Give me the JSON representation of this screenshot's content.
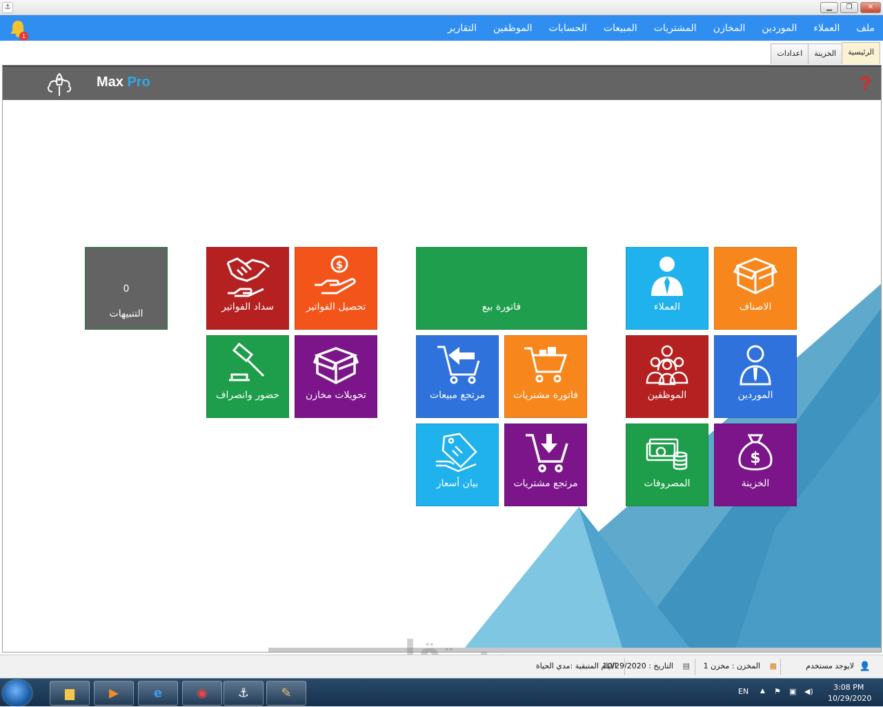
{
  "window": {
    "app_icon": "app-logo-icon",
    "controls": [
      "minimize-icon",
      "restore-icon",
      "close-icon"
    ]
  },
  "menu": {
    "items": [
      "ملف",
      "العملاء",
      "الموردين",
      "المخازن",
      "المشتريات",
      "المبيعات",
      "الحسابات",
      "الموظفين",
      "التقارير"
    ],
    "notification_count": "1",
    "bell_color": "#f5c12e"
  },
  "tabs": [
    "الرئيسية",
    "الخزينة",
    "اعدادات"
  ],
  "header": {
    "brand_main": "Max",
    "brand_accent": "Pro",
    "help_symbol": "?"
  },
  "tiles": [
    {
      "label": "الاصناف",
      "color": "#f7871c",
      "icon": "box-icon"
    },
    {
      "label": "العملاء",
      "color": "#1fb2ec",
      "icon": "customer-icon"
    },
    {
      "label": "الموردين",
      "color": "#2f72dc",
      "icon": "supplier-icon"
    },
    {
      "label": "الموظفين",
      "color": "#b52121",
      "icon": "employees-icon"
    },
    {
      "label": "الخزينة",
      "color": "#7b1589",
      "icon": "money-bag-icon"
    },
    {
      "label": "المصروفات",
      "color": "#1e9e4a",
      "icon": "cash-icon"
    },
    {
      "label": "فاتورة بيع",
      "color": "#1f9f4d",
      "icon": ""
    },
    {
      "label": "فاتورة مشتريات",
      "color": "#f7871c",
      "icon": "cart-icon"
    },
    {
      "label": "مرتجع مبيعات",
      "color": "#2f72dc",
      "icon": "cart-return-icon"
    },
    {
      "label": "مرتجع مشتريات",
      "color": "#7b1589",
      "icon": "cart-down-icon"
    },
    {
      "label": "بيان أسعار",
      "color": "#1fb2ec",
      "icon": "price-tag-icon"
    },
    {
      "label": "تحصيل الفواتير",
      "color": "#f2541a",
      "icon": "hand-coin-icon"
    },
    {
      "label": "سداد الفواتير",
      "color": "#b52121",
      "icon": "handshake-icon"
    },
    {
      "label": "تحويلات مخازن",
      "color": "#7b1589",
      "icon": "open-box-icon"
    },
    {
      "label": "حضور وانصراف",
      "color": "#1e9e4a",
      "icon": "gavel-icon"
    },
    {
      "label": "التنبيهات",
      "color": "#636363",
      "icon": "",
      "count": "0"
    }
  ],
  "status": {
    "user": "لايوجد مستخدم",
    "store": "المخزن : مخزن 1",
    "date": "التاريخ : 10/29/2020",
    "days_left": "الايام المتبقية :مدي الحياة"
  },
  "watermark": "مستقل",
  "taskbar": {
    "lang": "EN",
    "time": "3:08 PM",
    "date": "10/29/2020",
    "apps": [
      "explorer-icon",
      "media-player-icon",
      "ie-icon",
      "chrome-icon",
      "maxpro-icon",
      "paint-icon"
    ]
  }
}
